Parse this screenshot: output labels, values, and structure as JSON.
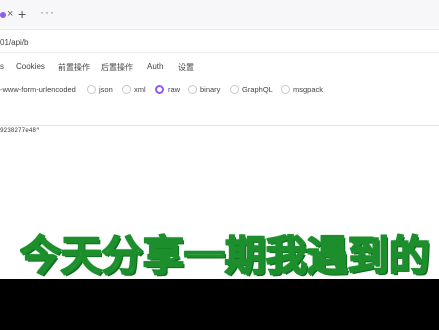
{
  "tabbar": {
    "close_glyph": "×",
    "add_glyph": "+",
    "more_glyph": "···"
  },
  "url": {
    "value": "01/api/b"
  },
  "request_tabs": [
    {
      "label": "s"
    },
    {
      "label": "Cookies"
    },
    {
      "label": "前置操作"
    },
    {
      "label": "后置操作"
    },
    {
      "label": "Auth"
    },
    {
      "label": "设置"
    }
  ],
  "body_types": [
    {
      "label": "-www-form-urlencoded",
      "selected": false
    },
    {
      "label": "json",
      "selected": false
    },
    {
      "label": "xml",
      "selected": false
    },
    {
      "label": "raw",
      "selected": true
    },
    {
      "label": "binary",
      "selected": false
    },
    {
      "label": "GraphQL",
      "selected": false
    },
    {
      "label": "msgpack",
      "selected": false
    }
  ],
  "body": {
    "content": "9238277e48\""
  },
  "subtitle": {
    "text": "今天分享一期我遇到的"
  },
  "colors": {
    "accent": "#8b5cf6",
    "subtitle_stroke": "#1c8f2c"
  }
}
